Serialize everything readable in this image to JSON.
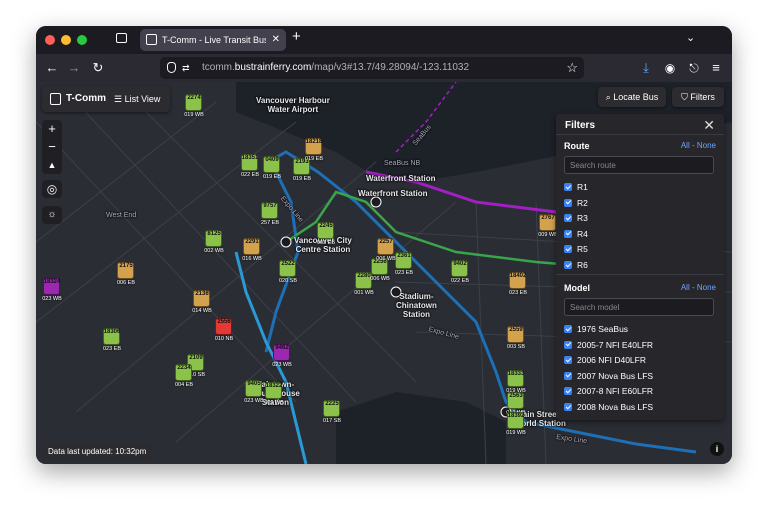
{
  "browser": {
    "tab_title": "T-Comm - Live Transit Bus Loca",
    "url_prefix": "tcomm.",
    "url_domain": "bustrainferry.com",
    "url_path": "/map/v3#13.7/49.28094/-123.11032"
  },
  "toolbar": {
    "brand": "T-Comm",
    "list_view": "List View",
    "locate_bus": "Locate Bus",
    "filters": "Filters"
  },
  "map_labels": {
    "harbour": "Vancouver Harbour\nWater Airport",
    "waterfront": "Waterfront Station",
    "waterfront2": "Waterfront Station",
    "city_centre": "Vancouver City\nCentre Station",
    "stadium": "Stadium-\nChinatown\nStation",
    "gastown": "Yaletown-\nRoundhouse\nStation",
    "main": "Main Street–\nWorld Station",
    "expo1": "Expo Line",
    "expo2": "Expo Line",
    "expo3": "Expo Line",
    "seabus": "SeaBus",
    "seabus_nb": "SeaBus NB",
    "westend": "West End"
  },
  "filters": {
    "title": "Filters",
    "route_title": "Route",
    "all": "All",
    "sep": "-",
    "none": "None",
    "route_search": "Search route",
    "routes": [
      "R1",
      "R2",
      "R3",
      "R4",
      "R5",
      "R6"
    ],
    "model_title": "Model",
    "model_search": "Search model",
    "models": [
      "1976 SeaBus",
      "2005-7 NFI E40LFR",
      "2006 NFI D40LFR",
      "2007 Nova Bus LFS",
      "2007-8 NFI E60LFR",
      "2008 Nova Bus LFS"
    ]
  },
  "status": "Data last updated: 10:32pm",
  "buses": [
    {
      "id": "2274",
      "dir": "019 WB",
      "color": "#8bc34a"
    },
    {
      "id": "18351",
      "dir": "022 EB",
      "color": "#8bc34a"
    },
    {
      "id": "0409",
      "dir": "019 EB",
      "color": "#8bc34a"
    },
    {
      "id": "2193",
      "dir": "019 EB",
      "color": "#8bc34a"
    },
    {
      "id": "18218",
      "dir": "019 EB",
      "color": "#d4a24c"
    },
    {
      "id": "8125",
      "dir": "002 WB",
      "color": "#8bc34a"
    },
    {
      "id": "2291",
      "dir": "016 WB",
      "color": "#d4a24c"
    },
    {
      "id": "2522",
      "dir": "020 SB",
      "color": "#8bc34a"
    },
    {
      "id": "2175",
      "dir": "006 EB",
      "color": "#d4a24c"
    },
    {
      "id": "2136",
      "dir": "014 WB",
      "color": "#d4a24c"
    },
    {
      "id": "2556",
      "dir": "010 NB",
      "color": "#e53935"
    },
    {
      "id": "18306",
      "dir": "023 EB",
      "color": "#8bc34a"
    },
    {
      "id": "2109",
      "dir": "010 SB",
      "color": "#8bc34a"
    },
    {
      "id": "2234",
      "dir": "004 EB",
      "color": "#8bc34a"
    },
    {
      "id": "2245",
      "dir": "003 EB",
      "color": "#8bc34a"
    },
    {
      "id": "2280",
      "dir": "001 WB",
      "color": "#8bc34a"
    },
    {
      "id": "2256",
      "dir": "006 WB",
      "color": "#8bc34a"
    },
    {
      "id": "2361",
      "dir": "023 EB",
      "color": "#8bc34a"
    },
    {
      "id": "9402",
      "dir": "022 EB",
      "color": "#8bc34a"
    },
    {
      "id": "2559",
      "dir": "003 SB",
      "color": "#d4a24c"
    },
    {
      "id": "18333",
      "dir": "019 WB",
      "color": "#8bc34a"
    },
    {
      "id": "2563",
      "dir": "019 WB",
      "color": "#8bc34a"
    },
    {
      "id": "18392",
      "dir": "019 WB",
      "color": "#8bc34a"
    },
    {
      "id": "2225",
      "dir": "017 SB",
      "color": "#8bc34a"
    },
    {
      "id": "18324",
      "dir": "023 WB",
      "color": "#9c27b0"
    },
    {
      "id": "9462",
      "dir": "023 WB",
      "color": "#9c27b0"
    },
    {
      "id": "2767",
      "dir": "009 WB",
      "color": "#d4a24c"
    },
    {
      "id": "18402",
      "dir": "023 EB",
      "color": "#d4a24c"
    },
    {
      "id": "2257",
      "dir": "006 WB",
      "color": "#d4a24c"
    },
    {
      "id": "9757",
      "dir": "257 EB",
      "color": "#8bc34a"
    },
    {
      "id": "9405",
      "dir": "023 WB",
      "color": "#8bc34a"
    },
    {
      "id": "18322",
      "dir": "009 WB",
      "color": "#8bc34a"
    }
  ]
}
